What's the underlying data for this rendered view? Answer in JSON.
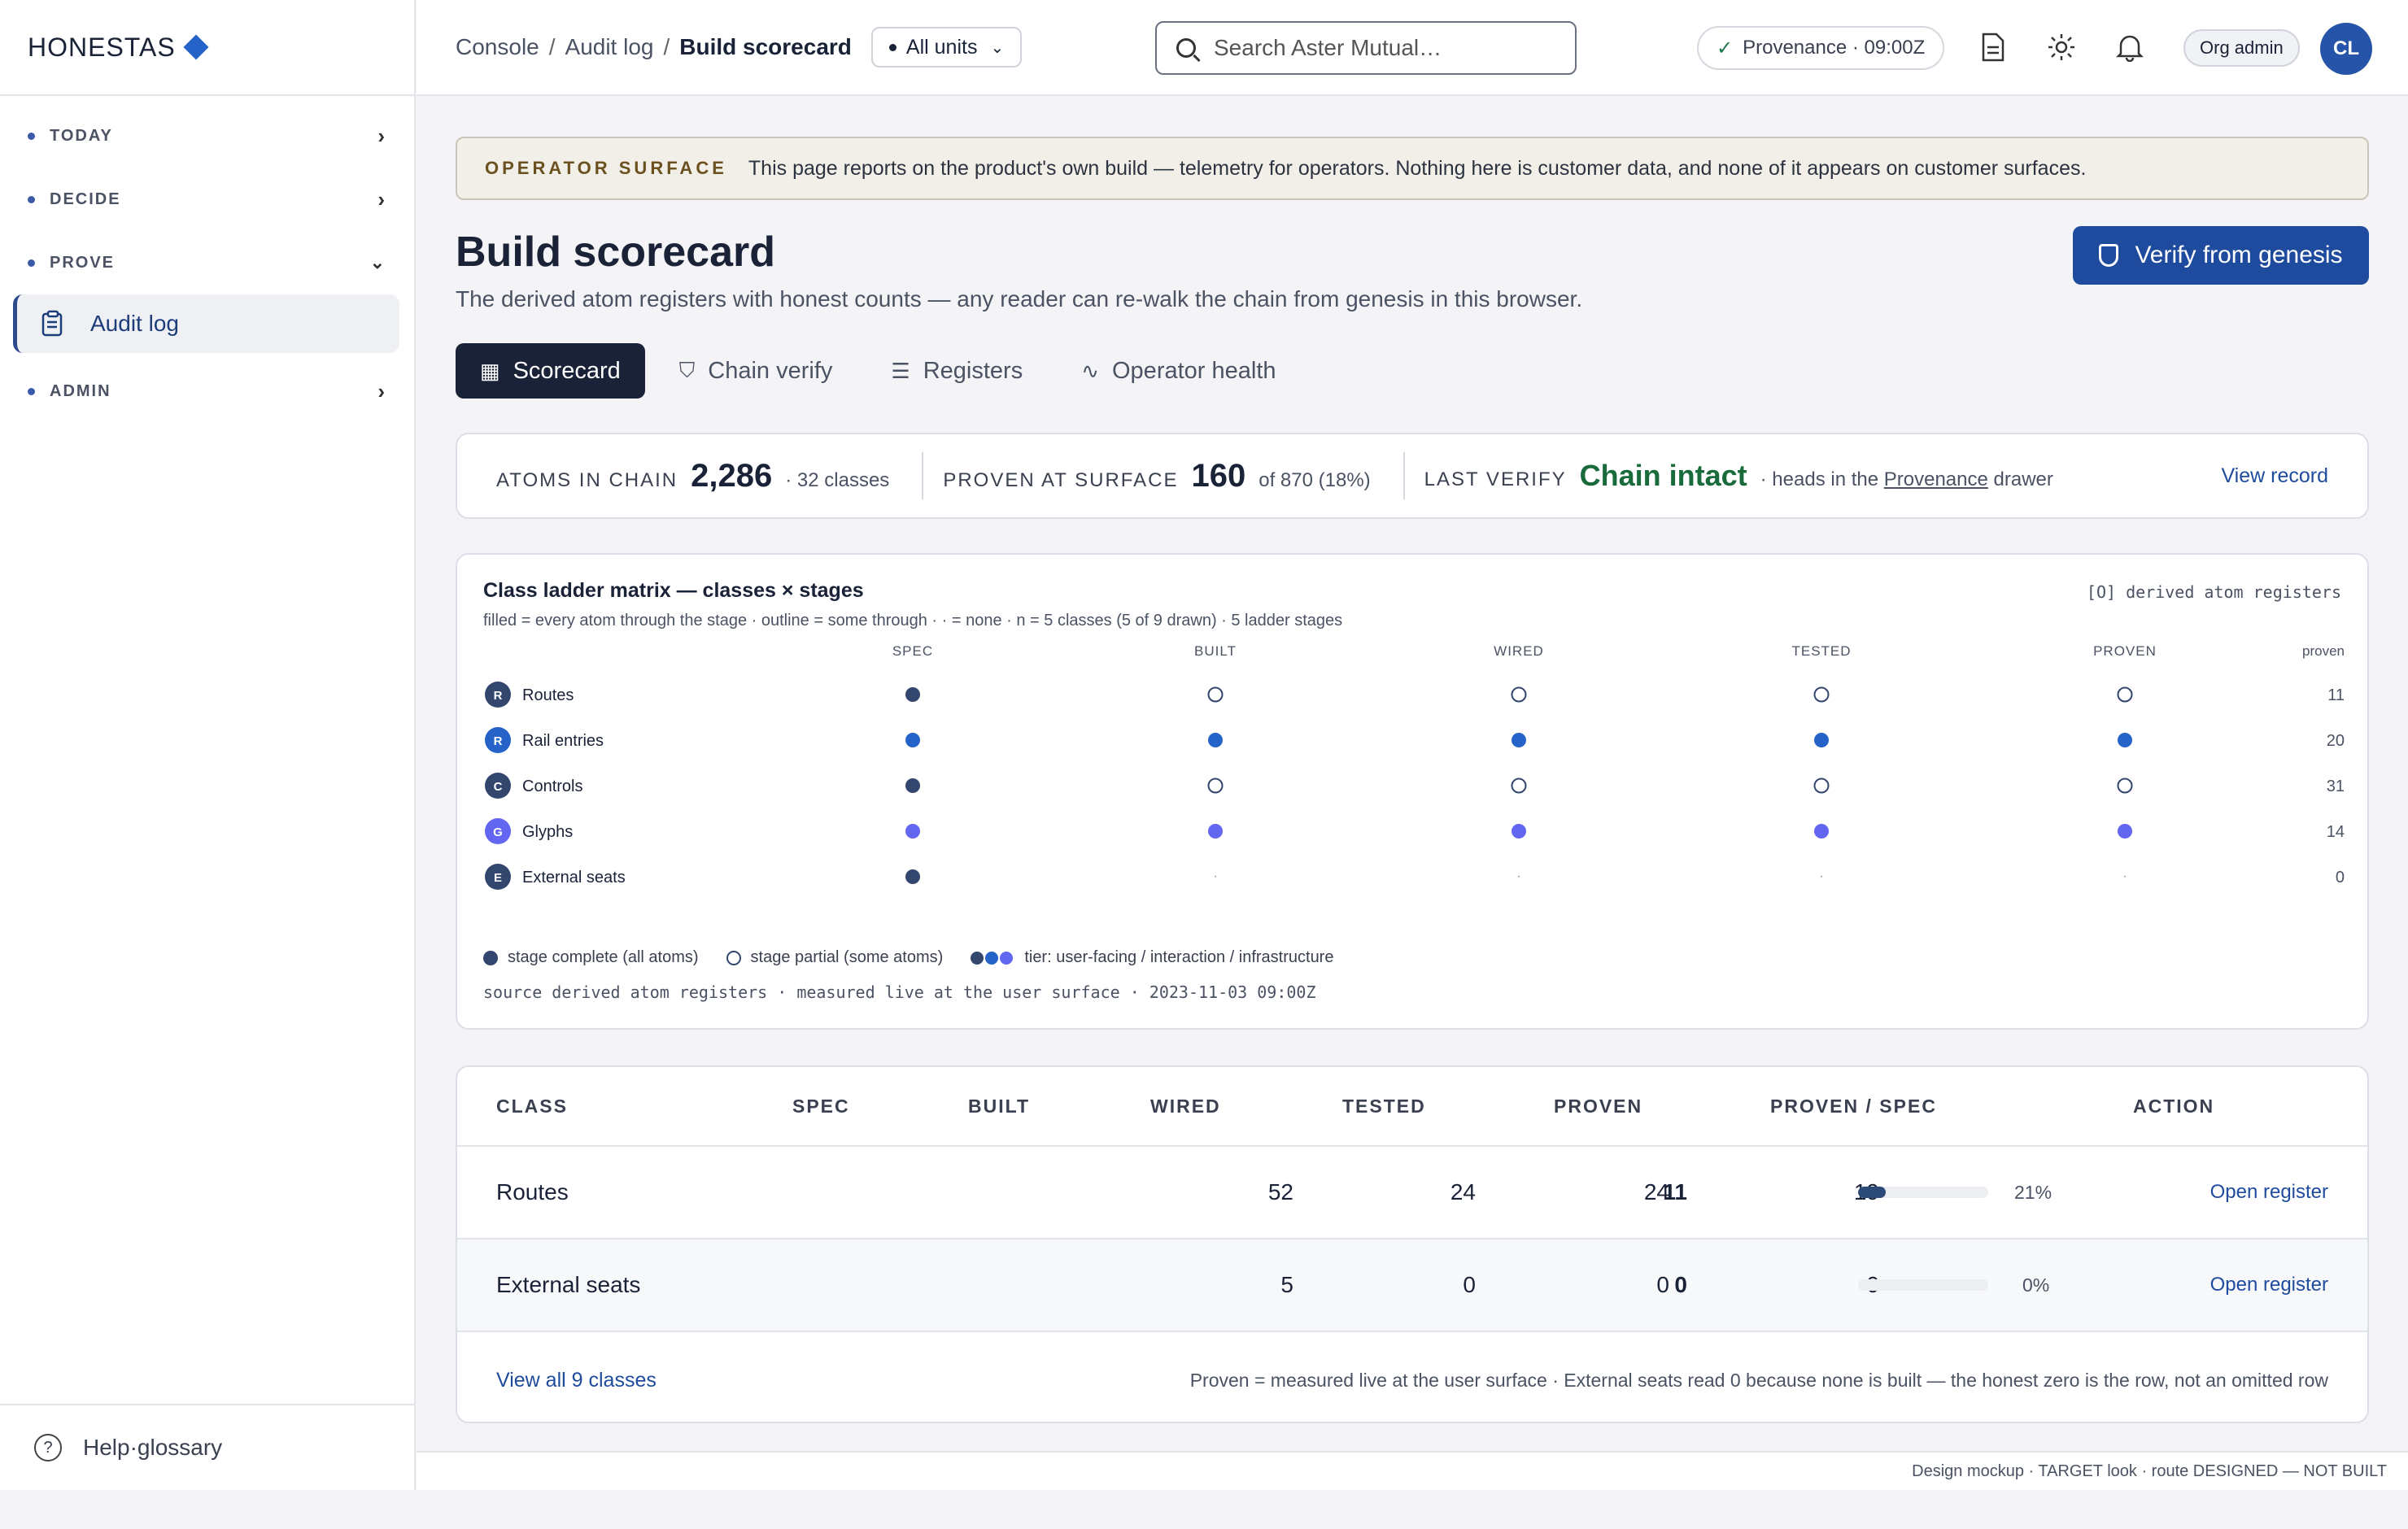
{
  "brand": {
    "name": "HONESTAS"
  },
  "sidebar": {
    "sections": [
      {
        "label": "TODAY",
        "chevron": "chevron-right-icon"
      },
      {
        "label": "DECIDE",
        "chevron": "chevron-right-icon"
      },
      {
        "label": "PROVE",
        "chevron": "chevron-down-icon"
      },
      {
        "label": "ADMIN",
        "chevron": "chevron-right-icon"
      }
    ],
    "active_item": {
      "label": "Audit log",
      "icon": "clipboard-icon"
    },
    "footer": {
      "label": "Help·glossary",
      "icon": "help-icon"
    }
  },
  "header": {
    "breadcrumb": [
      "Console",
      "Audit log",
      "Build scorecard"
    ],
    "units_select": "All units",
    "search_placeholder": "Search Aster Mutual…",
    "provenance": "Provenance · 09:00Z",
    "role": "Org admin",
    "avatar_initials": "CL"
  },
  "banner": {
    "tag": "OPERATOR SURFACE",
    "text": "This page reports on the product's own build — telemetry for operators. Nothing here is customer data, and none of it appears on customer surfaces."
  },
  "page": {
    "title": "Build scorecard",
    "subtitle": "The derived atom registers with honest counts — any reader can re-walk the chain from genesis in this browser.",
    "verify_button": "Verify from genesis"
  },
  "tabs": [
    {
      "label": "Scorecard",
      "icon": "table-icon",
      "active": true
    },
    {
      "label": "Chain verify",
      "icon": "shield-icon",
      "active": false
    },
    {
      "label": "Registers",
      "icon": "checklist-icon",
      "active": false
    },
    {
      "label": "Operator health",
      "icon": "pulse-icon",
      "active": false
    }
  ],
  "stats": {
    "atoms_label": "ATOMS IN CHAIN",
    "atoms_value": "2,286",
    "atoms_note": "· 32 classes",
    "proven_label": "PROVEN AT SURFACE",
    "proven_value": "160",
    "proven_note": "of 870 (18%)",
    "verify_label": "LAST VERIFY",
    "verify_value": "Chain intact",
    "verify_note_pre": "· heads in the",
    "verify_note_link": "Provenance",
    "verify_note_post": "drawer",
    "view_record": "View record"
  },
  "matrix": {
    "title": "Class ladder matrix — classes × stages",
    "subtitle": "filled = every atom through the stage · outline = some through · · = none · n = 5 classes (5 of 9 drawn) · 5 ladder stages",
    "tag": "[O] derived atom registers",
    "stages": [
      "SPEC",
      "BUILT",
      "WIRED",
      "TESTED",
      "PROVEN"
    ],
    "proven_header": "proven",
    "rows": [
      {
        "initial": "R",
        "name": "Routes",
        "tier": "infrastructure",
        "stages": [
          "full",
          "partial",
          "partial",
          "partial",
          "partial"
        ],
        "proven": "11"
      },
      {
        "initial": "R",
        "name": "Rail entries",
        "tier": "interaction",
        "stages": [
          "full",
          "full",
          "full",
          "full",
          "full"
        ],
        "proven": "20"
      },
      {
        "initial": "C",
        "name": "Controls",
        "tier": "infrastructure",
        "stages": [
          "full",
          "partial",
          "partial",
          "partial",
          "partial"
        ],
        "proven": "31"
      },
      {
        "initial": "G",
        "name": "Glyphs",
        "tier": "user-facing",
        "stages": [
          "full",
          "full",
          "full",
          "full",
          "full"
        ],
        "proven": "14"
      },
      {
        "initial": "E",
        "name": "External seats",
        "tier": "infrastructure",
        "stages": [
          "full",
          "none",
          "none",
          "none",
          "none"
        ],
        "proven": "0"
      }
    ],
    "none_glyph": "·",
    "tier_colors": {
      "infrastructure": "#33466e",
      "interaction": "#2563c9",
      "user-facing": "#6366f1"
    },
    "legend_full": "stage complete (all atoms)",
    "legend_partial": "stage partial (some atoms)",
    "legend_tier": "tier: user-facing / interaction / infrastructure",
    "footer": "source derived atom registers · measured live at the user surface · 2023-11-03 09:00Z"
  },
  "table": {
    "headers": [
      "CLASS",
      "SPEC",
      "BUILT",
      "WIRED",
      "TESTED",
      "PROVEN",
      "PROVEN / SPEC",
      "ACTION"
    ],
    "rows": [
      {
        "class": "Routes",
        "spec": "52",
        "built": "24",
        "wired": "24",
        "tested": "19",
        "proven": "11",
        "ratio": 0.21,
        "ratio_label": "21%",
        "action": "Open register"
      },
      {
        "class": "External seats",
        "spec": "5",
        "built": "0",
        "wired": "0",
        "tested": "0",
        "proven": "0",
        "ratio": 0,
        "ratio_label": "0%",
        "action": "Open register"
      }
    ],
    "view_all": "View all 9 classes",
    "note": "Proven = measured live at the user surface · External seats read 0 because none is built — the honest zero is the row, not an omitted row"
  },
  "footer_note": "Design mockup · TARGET look · route DESIGNED — NOT BUILT"
}
